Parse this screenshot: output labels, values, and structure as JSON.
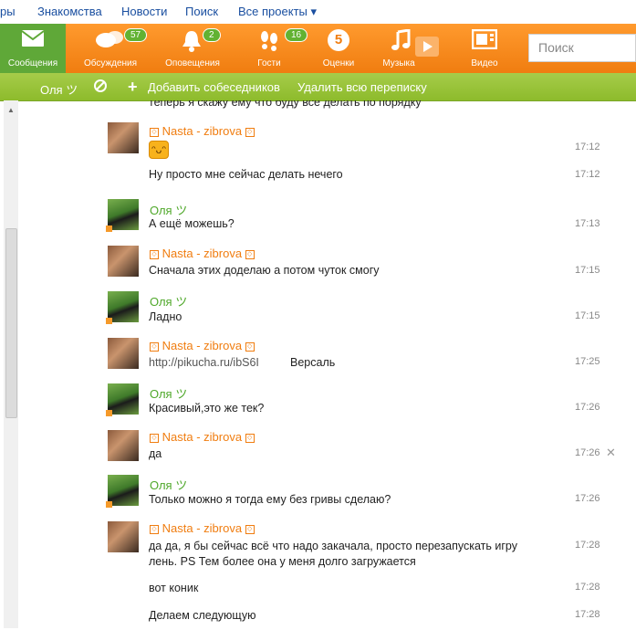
{
  "top_links": [
    "ры",
    "Знакомства",
    "Новости",
    "Поиск",
    "Все проекты ▾"
  ],
  "toolbar": {
    "items": [
      {
        "label": "Сообщения",
        "icon": "envelope-icon",
        "badge": ""
      },
      {
        "label": "Обсуждения",
        "icon": "chat-bubbles-icon",
        "badge": "57"
      },
      {
        "label": "Оповещения",
        "icon": "bell-icon",
        "badge": "2"
      },
      {
        "label": "Гости",
        "icon": "footprints-icon",
        "badge": "16"
      },
      {
        "label": "Оценки",
        "icon": "rating-icon",
        "badge": ""
      },
      {
        "label": "Музыка",
        "icon": "music-note-icon",
        "badge": ""
      },
      {
        "label": "Видео",
        "icon": "video-icon",
        "badge": ""
      }
    ],
    "search_placeholder": "Поиск",
    "rating_glyph": "5"
  },
  "chatbar": {
    "contact": "Оля ツ",
    "add_label": "Добавить собеседников",
    "delete_label": "Удалить всю переписку"
  },
  "cut_text": "теперь я скажу ему что буду всё делать по порядку",
  "messages": [
    {
      "author": "Nasta - zibrova",
      "who": "nasta",
      "text": "",
      "smiley": true,
      "time": "17:12"
    },
    {
      "author": "",
      "who": "nasta",
      "text": "Ну просто мне сейчас делать нечего",
      "time": "17:12"
    },
    {
      "author": "Оля ツ",
      "who": "olya",
      "text": "А ещё можешь?",
      "time": "17:13"
    },
    {
      "author": "Nasta - zibrova",
      "who": "nasta",
      "text": "Сначала этих доделаю а потом чуток смогу",
      "time": "17:15"
    },
    {
      "author": "Оля ツ",
      "who": "olya",
      "text": "Ладно",
      "time": "17:15"
    },
    {
      "author": "Nasta - zibrova",
      "who": "nasta",
      "text": "http://pikucha.ru/ibS6I",
      "text2": "Версаль",
      "time": "17:25"
    },
    {
      "author": "Оля ツ",
      "who": "olya",
      "text": "Красивый,это же тек?",
      "time": "17:26"
    },
    {
      "author": "Nasta - zibrova",
      "who": "nasta",
      "text": "да",
      "time": "17:26"
    },
    {
      "author": "Оля ツ",
      "who": "olya",
      "text": "Только можно я тогда ему без гривы сделаю?",
      "time": "17:26"
    },
    {
      "author": "Nasta - zibrova",
      "who": "nasta",
      "text": "да да, я бы сейчас всё что надо закачала, просто перезапускать игру",
      "text2": "лень. PS Тем более она у меня долго загружается",
      "time": "17:28"
    },
    {
      "author": "",
      "who": "nasta",
      "text": "вот коник",
      "time": "17:28"
    },
    {
      "author": "",
      "who": "nasta",
      "text": "Делаем следующую",
      "time": "17:28"
    }
  ],
  "colors": {
    "toolbar": "#f58a1f",
    "active": "#5fa838",
    "greenbar": "#9ac43b",
    "nasta": "#f07d10",
    "olya": "#4fa82a"
  }
}
